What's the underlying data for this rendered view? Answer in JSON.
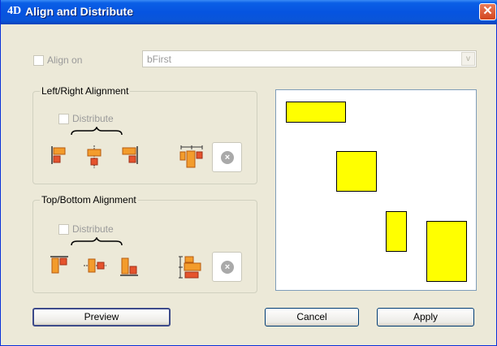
{
  "window": {
    "title": "Align and Distribute",
    "app_icon": "4D",
    "close": "✕"
  },
  "align_on": {
    "label": "Align on",
    "value": "bFirst",
    "arrow": "v"
  },
  "left_right": {
    "title": "Left/Right Alignment",
    "distribute_label": "Distribute",
    "cancel_icon": "×"
  },
  "top_bottom": {
    "title": "Top/Bottom Alignment",
    "distribute_label": "Distribute",
    "cancel_icon": "×"
  },
  "buttons": {
    "preview": "Preview",
    "cancel": "Cancel",
    "apply": "Apply"
  },
  "colors": {
    "highlight": "#ffff00",
    "icon_orange": "#f39c2c",
    "icon_red": "#e5532d"
  }
}
